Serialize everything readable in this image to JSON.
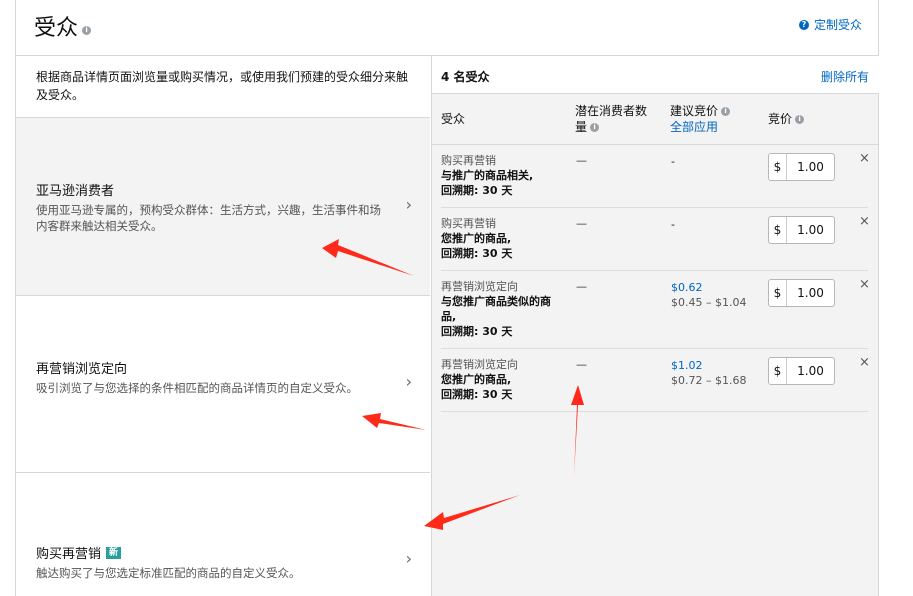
{
  "header": {
    "title": "受众",
    "custom_link": "定制受众"
  },
  "intro": "根据商品详情页面浏览量或购买情况，或使用我们预建的受众细分来触及受众。",
  "options": [
    {
      "title": "亚马逊消费者",
      "desc": "使用亚马逊专属的，预构受众群体：生活方式，兴趣，生活事件和场内客群来触达相关受众。",
      "badge": ""
    },
    {
      "title": "再营销浏览定向",
      "desc": "吸引浏览了与您选择的条件相匹配的商品详情页的自定义受众。",
      "badge": ""
    },
    {
      "title": "购买再营销",
      "desc": "触达购买了与您选定标准匹配的商品的自定义受众。",
      "badge": "新"
    }
  ],
  "panel": {
    "count": "4 名受众",
    "delete_all": "删除所有",
    "columns": {
      "audience": "受众",
      "potential_l1": "潜在消费者数",
      "potential_l2": "量",
      "suggested": "建议竞价",
      "apply_all": "全部应用",
      "bid": "竞价"
    },
    "rows": [
      {
        "type": "购买再营销",
        "line1": "与推广的商品相关,",
        "line2": "回溯期: 30 天",
        "line3": "",
        "potential": "—",
        "suggested_price": "",
        "suggested_plain": "-",
        "range": "",
        "currency": "$",
        "bid": "1.00"
      },
      {
        "type": "购买再营销",
        "line1": "您推广的商品,",
        "line2": "回溯期: 30 天",
        "line3": "",
        "potential": "—",
        "suggested_price": "",
        "suggested_plain": "-",
        "range": "",
        "currency": "$",
        "bid": "1.00"
      },
      {
        "type": "再营销浏览定向",
        "line1": "与您推广商品类似的商",
        "line2": "品,",
        "line3": "回溯期: 30 天",
        "potential": "—",
        "suggested_price": "$0.62",
        "suggested_plain": "",
        "range": "$0.45 – $1.04",
        "currency": "$",
        "bid": "1.00"
      },
      {
        "type": "再营销浏览定向",
        "line1": "您推广的商品,",
        "line2": "回溯期: 30 天",
        "line3": "",
        "potential": "—",
        "suggested_price": "$1.02",
        "suggested_plain": "",
        "range": "$0.72 – $1.68",
        "currency": "$",
        "bid": "1.00"
      }
    ]
  },
  "colors": {
    "link": "#0066c0",
    "annotation_arrow": "#ff2a1a",
    "badge": "#2a9e9e"
  }
}
